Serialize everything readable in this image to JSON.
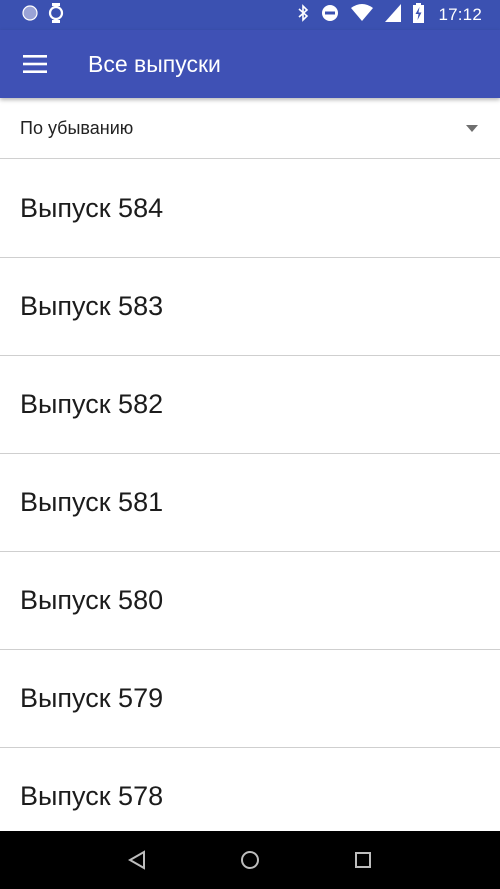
{
  "status_bar": {
    "time": "17:12",
    "icons": [
      "notification-dot-icon",
      "watch-icon",
      "bluetooth-icon",
      "do-not-disturb-icon",
      "wifi-icon",
      "battery-charging-icon"
    ]
  },
  "app_bar": {
    "title": "Все выпуски",
    "menu_icon": "hamburger-menu-icon",
    "color": "#3f51b5"
  },
  "sort": {
    "selected": "По убыванию",
    "icon": "dropdown-arrow-icon"
  },
  "issues": [
    {
      "label": "Выпуск 584"
    },
    {
      "label": "Выпуск 583"
    },
    {
      "label": "Выпуск 582"
    },
    {
      "label": "Выпуск 581"
    },
    {
      "label": "Выпуск 580"
    },
    {
      "label": "Выпуск 579"
    },
    {
      "label": "Выпуск 578"
    }
  ],
  "nav_bar": {
    "icons": [
      "back-icon",
      "home-icon",
      "recents-icon"
    ]
  }
}
